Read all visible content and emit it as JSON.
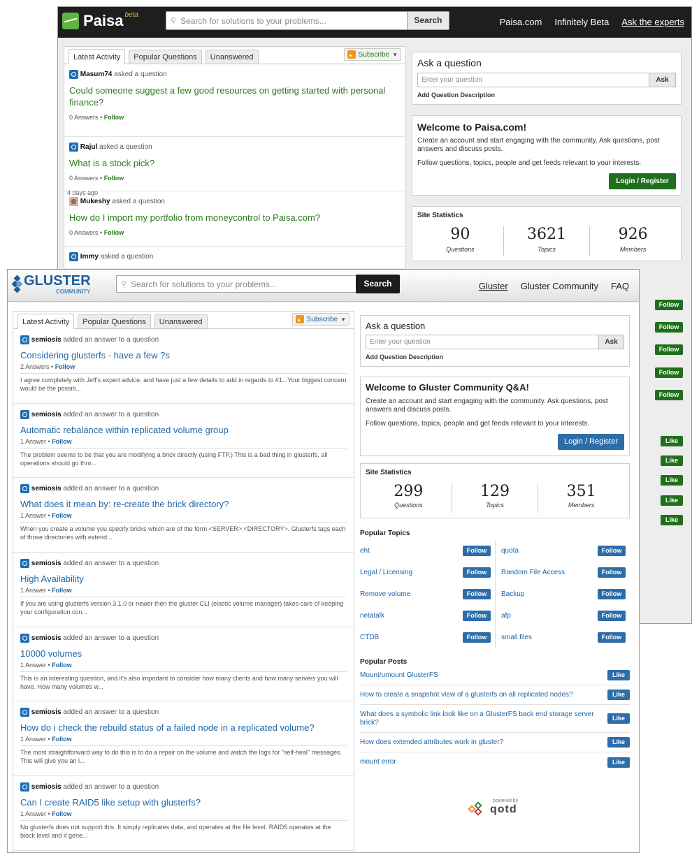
{
  "paisa": {
    "logo": "Paisa",
    "beta": "beta",
    "search_placeholder": "Search for solutions to your problems...",
    "search_button": "Search",
    "nav": [
      "Paisa.com",
      "Infinitely Beta",
      "Ask the experts"
    ],
    "tabs": [
      "Latest Activity",
      "Popular Questions",
      "Unanswered"
    ],
    "subscribe": "Subscribe",
    "activity": [
      {
        "user": "Masum74",
        "action": "asked a question",
        "question": "Could someone suggest a few good resources on getting started with personal finance?",
        "answers": "0 Answers",
        "follow": "Follow"
      },
      {
        "user": "Rajul",
        "action": "asked a question",
        "question": "What is a stock pick?",
        "answers": "0 Answers",
        "follow": "Follow"
      },
      {
        "user": "Mukeshy",
        "action": "asked a question",
        "question": "How do I import my portfolio from moneycontrol to Paisa.com?",
        "answers": "0 Answers",
        "follow": "Follow"
      },
      {
        "user": "Immy",
        "action": "asked a question"
      }
    ],
    "days_ago": "4 days ago",
    "ask": {
      "title": "Ask a question",
      "placeholder": "Enter your question",
      "button": "Ask",
      "add_description": "Add Question Description"
    },
    "welcome": {
      "title": "Welcome to Paisa.com!",
      "p1": "Create an account and start engaging with the community. Ask questions, post answers and discuss posts.",
      "p2": "Follow questions, topics, people and get feeds relevant to your interests.",
      "login": "Login / Register"
    },
    "stats": {
      "title": "Site Statistics",
      "items": [
        {
          "num": "90",
          "label": "Questions"
        },
        {
          "num": "3621",
          "label": "Topics"
        },
        {
          "num": "926",
          "label": "Members"
        }
      ]
    },
    "follow_label": "Follow",
    "like_label": "Like"
  },
  "gluster": {
    "logo": "GLUSTER",
    "logo_sub": "COMMUNITY",
    "search_placeholder": "Search for solutions to your problems...",
    "search_button": "Search",
    "nav": [
      "Gluster",
      "Gluster Community",
      "FAQ"
    ],
    "tabs": [
      "Latest Activity",
      "Popular Questions",
      "Unanswered"
    ],
    "subscribe": "Subscribe",
    "activity": [
      {
        "user": "semiosis",
        "action": "added an answer to a question",
        "question": "Considering glusterfs - have a few ?s",
        "answers": "2 Answers",
        "follow": "Follow",
        "snippet": "I agree completely with Jeff's expert advice, and have just a few details to add in regards to #1...Your biggest concern would be the possib..."
      },
      {
        "user": "semiosis",
        "action": "added an answer to a question",
        "question": "Automatic rebalance within replicated volume group",
        "answers": "1 Answer",
        "follow": "Follow",
        "snippet": "The problem seems to be that you are modifying a brick directly (using FTP.) This is a bad thing in glusterfs, all operations should go thro..."
      },
      {
        "user": "semiosis",
        "action": "added an answer to a question",
        "question": "What does it mean by: re-create the brick directory?",
        "answers": "1 Answer",
        "follow": "Follow",
        "snippet": "When you create a volume you specify bricks which are of the form <SERVER>:<DIRECTORY>. Glusterfs tags each of those directories with extend..."
      },
      {
        "user": "semiosis",
        "action": "added an answer to a question",
        "question": "High Availability",
        "answers": "1 Answer",
        "follow": "Follow",
        "snippet": "If you are using glusterfs version 3.1.0 or newer then the gluster CLI (elastic volume manager) takes care of keeping your configuration con..."
      },
      {
        "user": "semiosis",
        "action": "added an answer to a question",
        "question": "10000 volumes",
        "answers": "1 Answer",
        "follow": "Follow",
        "snippet": "This is an interesting question, and it's also important to consider how many clients and how many servers you will have. How many volumes w..."
      },
      {
        "user": "semiosis",
        "action": "added an answer to a question",
        "question": "How do i check the rebuild status of a failed node in a replicated volume?",
        "answers": "1 Answer",
        "follow": "Follow",
        "snippet": "The most straightforward way to do this is to do a repair on the volume and watch the logs for \"self-heal\" messages. This will give you an i..."
      },
      {
        "user": "semiosis",
        "action": "added an answer to a question",
        "question": "Can I create RAID5 like setup with glusterfs?",
        "answers": "1 Answer",
        "follow": "Follow",
        "snippet": "No glusterfs does not support this. It simply replicates data, and operates at the file level. RAID5 operates at the block level and it gene..."
      }
    ],
    "ask": {
      "title": "Ask a question",
      "placeholder": "Enter your question",
      "button": "Ask",
      "add_description": "Add Question Description"
    },
    "welcome": {
      "title": "Welcome to Gluster Community Q&A!",
      "p1": "Create an account and start engaging with the community. Ask questions, post answers and discuss posts.",
      "p2": "Follow questions, topics, people and get feeds relevant to your interests.",
      "login": "Login / Register"
    },
    "stats": {
      "title": "Site Statistics",
      "items": [
        {
          "num": "299",
          "label": "Questions"
        },
        {
          "num": "129",
          "label": "Topics"
        },
        {
          "num": "351",
          "label": "Members"
        }
      ]
    },
    "popular_topics": {
      "title": "Popular Topics",
      "left": [
        "eht",
        "Legal / Licensing",
        "Remove volume",
        "netatalk",
        "CTDB"
      ],
      "right": [
        "quota",
        "Random File Access",
        "Backup",
        "afp",
        "small files"
      ],
      "follow": "Follow"
    },
    "popular_posts": {
      "title": "Popular Posts",
      "items": [
        "Mount/umount GlusterFS",
        "How to create a snapshot view of a glusterfs on all replicated nodes?",
        "What does a symbolic link look like on a GlusterFS back end storage server brick?",
        "How does extended attributes work in gluster?",
        "mount error"
      ],
      "like": "Like"
    },
    "powered_by": "powered by",
    "powered_brand": "qotd"
  },
  "colors": {
    "paisa_green": "#1f6f1c",
    "gluster_blue": "#2d6da8",
    "link_blue": "#2166a5"
  }
}
